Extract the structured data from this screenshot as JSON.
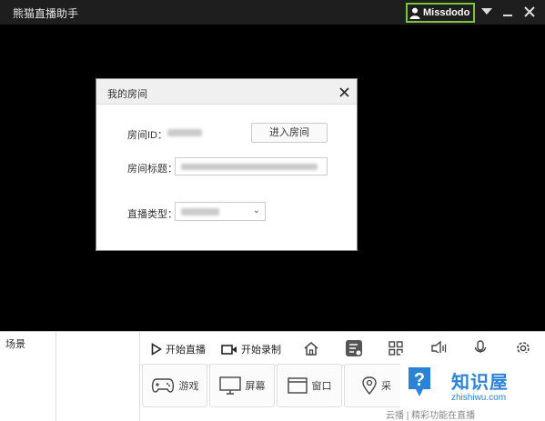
{
  "app": {
    "title": "熊猫直播助手",
    "username": "Missdodo"
  },
  "dialog": {
    "title": "我的房间",
    "room_id_label": "房间ID：",
    "enter_room_label": "进入房间",
    "room_title_label": "房间标题：",
    "live_type_label": "直播类型：",
    "live_type_chevron": "⌄"
  },
  "bottom": {
    "scene_label": "场景",
    "start_live_label": "开始直播",
    "start_record_label": "开始录制",
    "sources": [
      {
        "label": "游戏"
      },
      {
        "label": "屏幕"
      },
      {
        "label": "窗口"
      },
      {
        "label": "采"
      }
    ],
    "footer_text": "云播 | 精彩功能在直播"
  },
  "watermark": {
    "title": "知识屋",
    "url": "zhishiwu.com"
  },
  "colors": {
    "accent_green": "#7cc43c",
    "titlebar": "#1e1e1e",
    "watermark_blue": "#2b83d6"
  }
}
